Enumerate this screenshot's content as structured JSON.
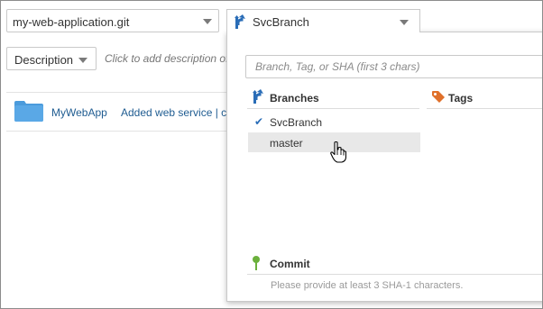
{
  "toolbar": {
    "repository": "my-web-application.git",
    "branch": "SvcBranch"
  },
  "description": {
    "select_label": "Description",
    "hint": "Click to add description of this repository"
  },
  "file_row": {
    "name": "MyWebApp",
    "commit_message": "Added web service | code"
  },
  "dropdown": {
    "search_placeholder": "Branch, Tag, or SHA (first 3 chars)",
    "branches_heading": "Branches",
    "tags_heading": "Tags",
    "branches": [
      {
        "label": "SvcBranch",
        "selected": true
      },
      {
        "label": "master",
        "selected": false,
        "hovered": true
      }
    ],
    "commit_heading": "Commit",
    "commit_hint": "Please provide at least 3 SHA-1 characters."
  },
  "icons": {
    "branch": "branch-icon",
    "tag": "tag-icon",
    "commit": "pin-icon",
    "folder": "folder-icon",
    "check": "check-icon",
    "cursor": "hand-cursor-icon"
  },
  "colors": {
    "link": "#1f5c91",
    "branch_icon": "#2a6db7",
    "tag_icon": "#e0702a",
    "commit_icon": "#6bb03c",
    "folder": "#4b9bdc",
    "hover_row": "#e8e8e8"
  }
}
